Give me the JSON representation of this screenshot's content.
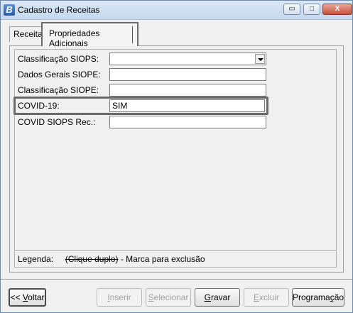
{
  "window": {
    "title": "Cadastro de Receitas",
    "app_icon_letter": "B",
    "controls": {
      "minimize": "▭",
      "maximize": "□",
      "close": "X"
    }
  },
  "tabs": [
    {
      "label": "Receita",
      "active": false
    },
    {
      "label": "Propriedades Adicionais",
      "active": true
    }
  ],
  "form": {
    "classificacao_siops": {
      "label": "Classificação SIOPS:",
      "value": ""
    },
    "dados_gerais_siope": {
      "label": "Dados Gerais SIOPE:",
      "value": ""
    },
    "classificacao_siope": {
      "label": "Classificação SIOPE:",
      "value": ""
    },
    "covid19": {
      "label": "COVID-19:",
      "value": "SIM"
    },
    "covid_siops_rec": {
      "label": "COVID SIOPS Rec.:",
      "value": ""
    }
  },
  "legend": {
    "label": "Legenda:",
    "strike_text": "(Clique duplo)",
    "description": "- Marca para exclusão"
  },
  "buttons": {
    "voltar": {
      "prefix": "<< ",
      "underlined": "V",
      "rest": "oltar"
    },
    "inserir": {
      "underlined": "I",
      "rest": "nserir"
    },
    "selecionar": {
      "underlined": "S",
      "rest": "elecionar"
    },
    "gravar": {
      "underlined": "G",
      "rest": "ravar"
    },
    "excluir": {
      "underlined": "E",
      "rest": "xcluir"
    },
    "programacao": {
      "prefix": "Programa",
      "underlined": "ç",
      "rest": "ão"
    }
  },
  "colors": {
    "titlebar": "#c6d9ee",
    "highlight_border": "#6a6a6a",
    "disabled_text": "#a0a0a0"
  }
}
